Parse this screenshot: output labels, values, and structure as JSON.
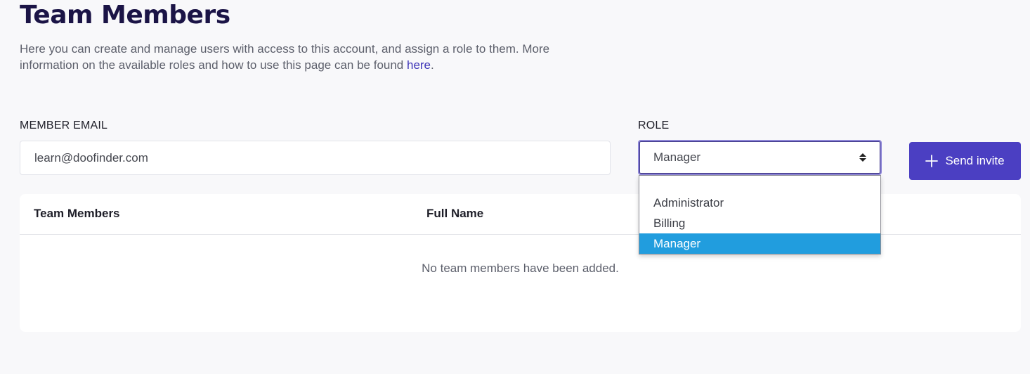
{
  "page": {
    "title": "Team Members",
    "intro_text": "Here you can create and manage users with access to this account, and assign a role to them. More information on the available roles and how to use this page can be found ",
    "intro_link": "here",
    "intro_end": "."
  },
  "form": {
    "email_label": "MEMBER EMAIL",
    "email_value": "learn@doofinder.com",
    "role_label": "ROLE",
    "role_value": "Manager",
    "role_options": [
      "Administrator",
      "Billing",
      "Manager"
    ],
    "send_label": "Send invite"
  },
  "table": {
    "headers": [
      "Team Members",
      "Full Name"
    ],
    "empty_message": "No team members have been added."
  },
  "colors": {
    "title": "#1b1446",
    "accent": "#4b3fc2",
    "link": "#3f36b8",
    "option_highlight": "#219dde"
  },
  "icons": {
    "send_button": "plus-icon",
    "role_select": "select-arrows-icon"
  }
}
